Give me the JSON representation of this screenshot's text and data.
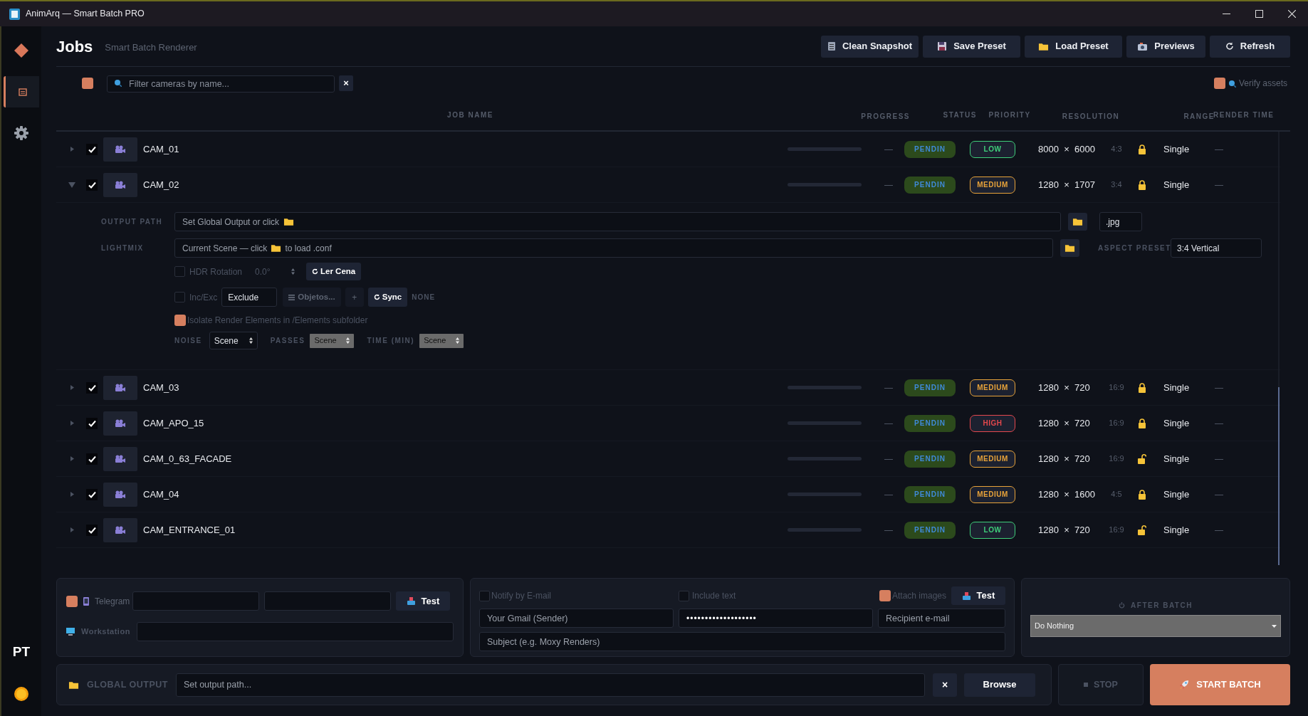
{
  "window": {
    "title": "AnimArq — Smart Batch PRO"
  },
  "sidebar": {
    "items": [
      {
        "kind": "logo",
        "selected": false
      },
      {
        "kind": "jobs",
        "selected": true
      },
      {
        "kind": "settings",
        "selected": false
      }
    ],
    "language": "PT"
  },
  "header": {
    "title": "Jobs",
    "subtitle": "Smart Batch Renderer"
  },
  "toolbar": [
    {
      "kind": "clipboard",
      "label": "Clean Snapshot"
    },
    {
      "kind": "floppy",
      "label": "Save Preset"
    },
    {
      "kind": "folder",
      "label": "Load Preset"
    },
    {
      "kind": "camera",
      "label": "Previews"
    },
    {
      "kind": "refresh",
      "label": "Refresh"
    }
  ],
  "filter": {
    "checked": true,
    "placeholder": "Filter cameras by name...",
    "clear": "×",
    "verify": {
      "checked": true,
      "label": "Verify assets"
    }
  },
  "table": {
    "columns": [
      "JOB NAME",
      "PROGRESS",
      "STATUS",
      "PRIORITY",
      "RESOLUTION",
      "RANGE",
      "RENDER TIME"
    ],
    "rows": [
      {
        "name": "CAM_01",
        "checked": true,
        "expanded": false,
        "level": 0,
        "progress": "—",
        "status": "PENDIN",
        "priority": {
          "label": "LOW",
          "color": "#3fcf7a"
        },
        "resolution": "8000  ×  6000",
        "ratio": "4:3",
        "locked": true,
        "range": "Single",
        "render_time": "—"
      },
      {
        "name": "CAM_02",
        "checked": true,
        "expanded": true,
        "level": 0,
        "progress": "—",
        "status": "PENDIN",
        "priority": {
          "label": "MEDIUM",
          "color": "#e8a33a"
        },
        "resolution": "1280  ×  1707",
        "ratio": "3:4",
        "locked": true,
        "range": "Single",
        "render_time": "—",
        "details": {
          "output_label": "OUTPUT PATH",
          "output_placeholder": "Set Global Output or click",
          "extension": ".jpg",
          "lightmix_label": "LIGHTMIX",
          "lightmix_before": "Current Scene — click",
          "lightmix_after": "to load .conf",
          "aspect_label": "ASPECT PRESET",
          "aspect_value": "3:4 Vertical",
          "hdr": {
            "checked": false,
            "label": "HDR Rotation",
            "value": "0.0°",
            "button": "Ler Cena"
          },
          "inc_exc": {
            "checked": false,
            "label": "Inc/Exc",
            "mode": "Exclude",
            "objects": "Objetos...",
            "plus": "+",
            "sync": "Sync",
            "state": "NONE"
          },
          "isolate": {
            "checked": true,
            "label": "Isolate Render Elements in /Elements subfolder"
          },
          "selects": [
            {
              "label": "NOISE",
              "value": "Scene",
              "kind": "dark"
            },
            {
              "label": "PASSES",
              "value": "Scene",
              "kind": "grey"
            },
            {
              "label": "TIME (MIN)",
              "value": "Scene",
              "kind": "grey"
            }
          ]
        }
      },
      {
        "name": "CAM_03",
        "checked": true,
        "expanded": false,
        "level": 0,
        "progress": "—",
        "status": "PENDIN",
        "priority": {
          "label": "MEDIUM",
          "color": "#e8a33a"
        },
        "resolution": "1280  ×  720",
        "ratio": "16:9",
        "locked": true,
        "range": "Single",
        "render_time": "—"
      },
      {
        "name": "CAM_APO_15",
        "checked": true,
        "expanded": false,
        "level": 0,
        "progress": "—",
        "status": "PENDIN",
        "priority": {
          "label": "HIGH",
          "color": "#e5484d"
        },
        "resolution": "1280  ×  720",
        "ratio": "16:9",
        "locked": true,
        "range": "Single",
        "render_time": "—"
      },
      {
        "name": "CAM_0_63_FACADE",
        "checked": true,
        "expanded": false,
        "level": 0,
        "progress": "—",
        "status": "PENDIN",
        "priority": {
          "label": "MEDIUM",
          "color": "#e8a33a"
        },
        "resolution": "1280  ×  720",
        "ratio": "16:9",
        "locked": false,
        "range": "Single",
        "render_time": "—"
      },
      {
        "name": "CAM_04",
        "checked": true,
        "expanded": false,
        "level": 0,
        "progress": "—",
        "status": "PENDIN",
        "priority": {
          "label": "MEDIUM",
          "color": "#e8a33a"
        },
        "resolution": "1280  ×  1600",
        "ratio": "4:5",
        "locked": true,
        "range": "Single",
        "render_time": "—"
      },
      {
        "name": "CAM_ENTRANCE_01",
        "checked": true,
        "expanded": false,
        "level": 0,
        "progress": "—",
        "status": "PENDIN",
        "priority": {
          "label": "LOW",
          "color": "#3fcf7a"
        },
        "resolution": "1280  ×  720",
        "ratio": "16:9",
        "locked": false,
        "range": "Single",
        "render_time": "—"
      }
    ]
  },
  "telegram": {
    "checked": true,
    "label": "Telegram",
    "test": "Test",
    "workstation": "Workstation"
  },
  "email": {
    "checked": false,
    "label": "Notify by E-mail",
    "include_text": {
      "checked": false,
      "label": "Include text"
    },
    "attach_images": {
      "checked": true,
      "label": "Attach images"
    },
    "test": "Test",
    "sender_placeholder": "Your Gmail (Sender)",
    "password": "•••••••••••••••••••",
    "recipient_placeholder": "Recipient e-mail",
    "subject_placeholder": "Subject (e.g. Moxy Renders)"
  },
  "after_batch": {
    "label": "AFTER BATCH",
    "value": "Do Nothing"
  },
  "global_output": {
    "label": "GLOBAL OUTPUT",
    "placeholder": "Set output path...",
    "clear": "×",
    "browse": "Browse"
  },
  "stop": "STOP",
  "start": "START BATCH"
}
